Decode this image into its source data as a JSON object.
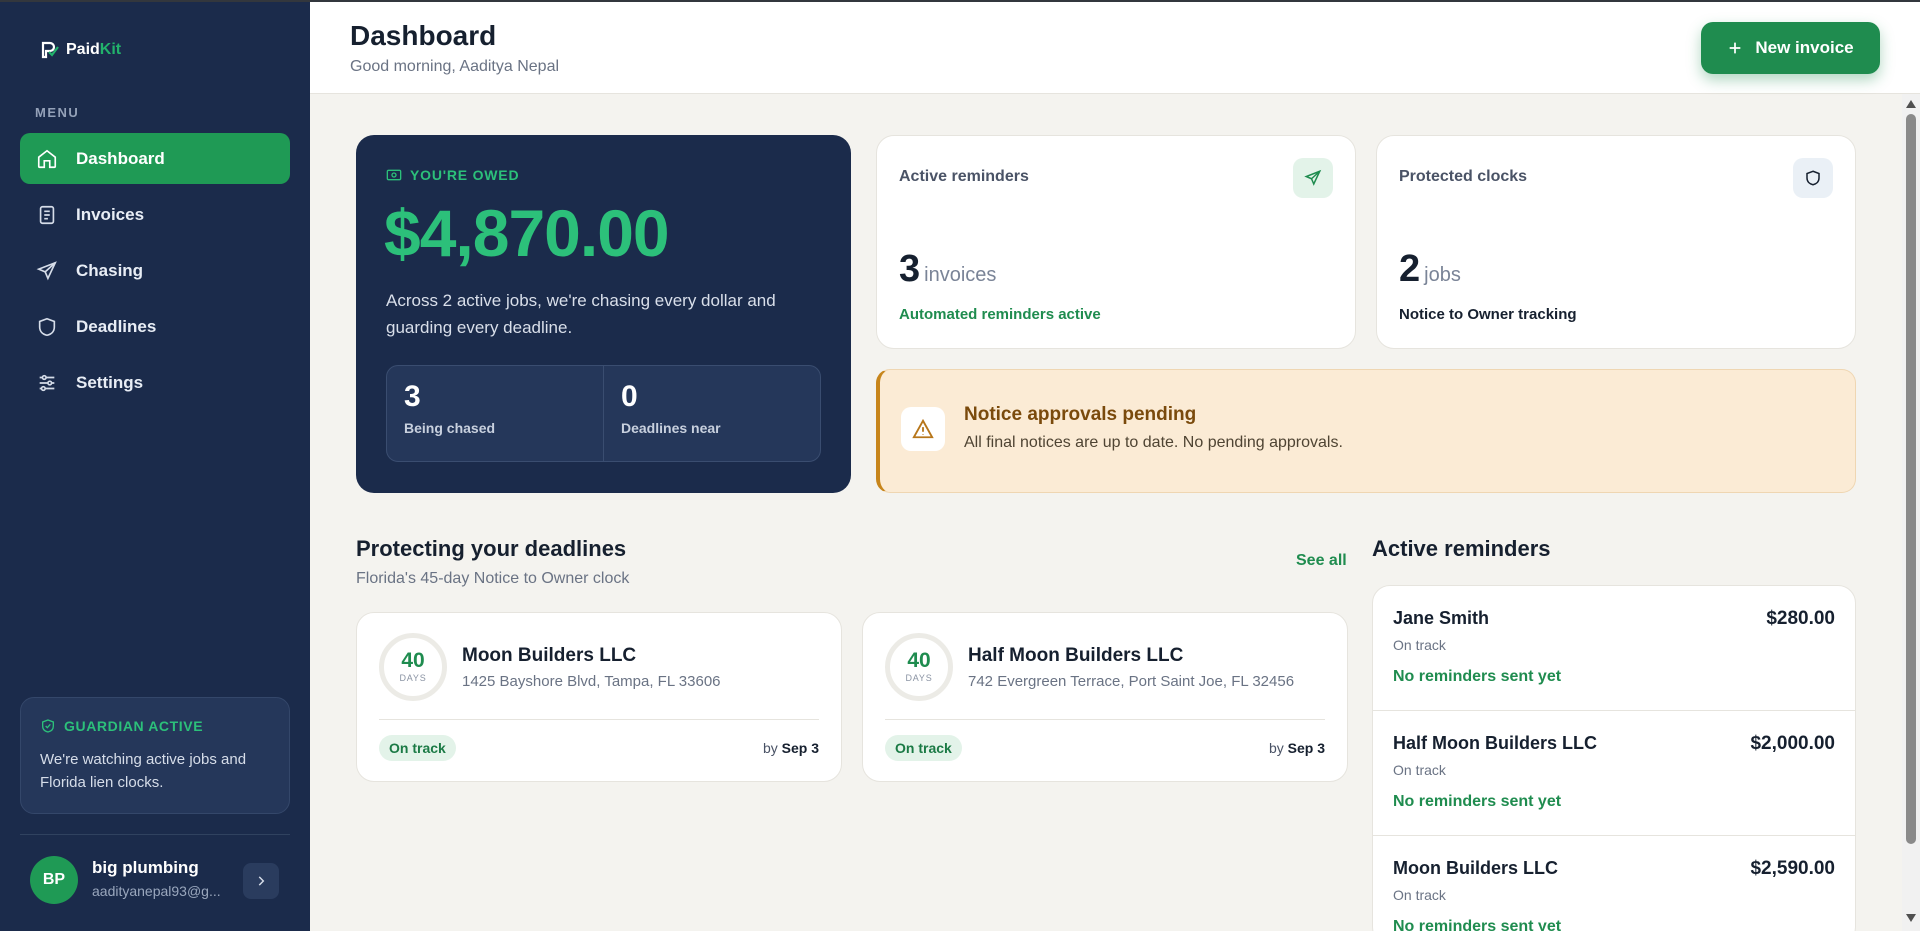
{
  "brand": {
    "name_part1": "Paid",
    "name_part2": "Kit"
  },
  "sidebar": {
    "menu_label": "MENU",
    "items": [
      {
        "label": "Dashboard",
        "icon": "home-icon",
        "active": true
      },
      {
        "label": "Invoices",
        "icon": "document-icon",
        "active": false
      },
      {
        "label": "Chasing",
        "icon": "send-icon",
        "active": false
      },
      {
        "label": "Deadlines",
        "icon": "shield-icon",
        "active": false
      },
      {
        "label": "Settings",
        "icon": "sliders-icon",
        "active": false
      }
    ],
    "guardian": {
      "title": "GUARDIAN ACTIVE",
      "text": "We're watching active jobs and Florida lien clocks."
    },
    "user": {
      "initials": "BP",
      "name": "big plumbing",
      "email": "aadityanepal93@g..."
    }
  },
  "header": {
    "title": "Dashboard",
    "greeting": "Good morning, Aaditya Nepal",
    "new_invoice_label": "New invoice"
  },
  "owed": {
    "label": "YOU'RE OWED",
    "amount": "$4,870.00",
    "description": "Across 2 active jobs, we're chasing every dollar and guarding every deadline.",
    "stats": [
      {
        "value": "3",
        "label": "Being chased"
      },
      {
        "value": "0",
        "label": "Deadlines near"
      }
    ]
  },
  "active_reminders_card": {
    "title": "Active reminders",
    "value": "3",
    "unit": "invoices",
    "subtitle": "Automated reminders active"
  },
  "protected_clocks_card": {
    "title": "Protected clocks",
    "value": "2",
    "unit": "jobs",
    "subtitle": "Notice to Owner tracking"
  },
  "notice": {
    "title": "Notice approvals pending",
    "text": "All final notices are up to date. No pending approvals."
  },
  "deadlines": {
    "title": "Protecting your deadlines",
    "subtitle": "Florida's 45-day Notice to Owner clock",
    "see_all": "See all",
    "cards": [
      {
        "days": "40",
        "days_label": "DAYS",
        "name": "Moon Builders LLC",
        "address": "1425 Bayshore Blvd, Tampa, FL 33606",
        "status": "On track",
        "by_prefix": "by",
        "by_date": "Sep 3"
      },
      {
        "days": "40",
        "days_label": "DAYS",
        "name": "Half Moon Builders LLC",
        "address": "742 Evergreen Terrace, Port Saint Joe, FL 32456",
        "status": "On track",
        "by_prefix": "by",
        "by_date": "Sep 3"
      }
    ]
  },
  "reminders": {
    "title": "Active reminders",
    "items": [
      {
        "name": "Jane Smith",
        "status": "On track",
        "note": "No reminders sent yet",
        "amount": "$280.00"
      },
      {
        "name": "Half Moon Builders LLC",
        "status": "On track",
        "note": "No reminders sent yet",
        "amount": "$2,000.00"
      },
      {
        "name": "Moon Builders LLC",
        "status": "On track",
        "note": "No reminders sent yet",
        "amount": "$2,590.00"
      }
    ]
  },
  "colors": {
    "navy": "#1b2b4b",
    "green": "#1f9a55",
    "accent_green": "#2cc07a",
    "amber": "#c7851b",
    "page_bg": "#f4f3ef"
  }
}
